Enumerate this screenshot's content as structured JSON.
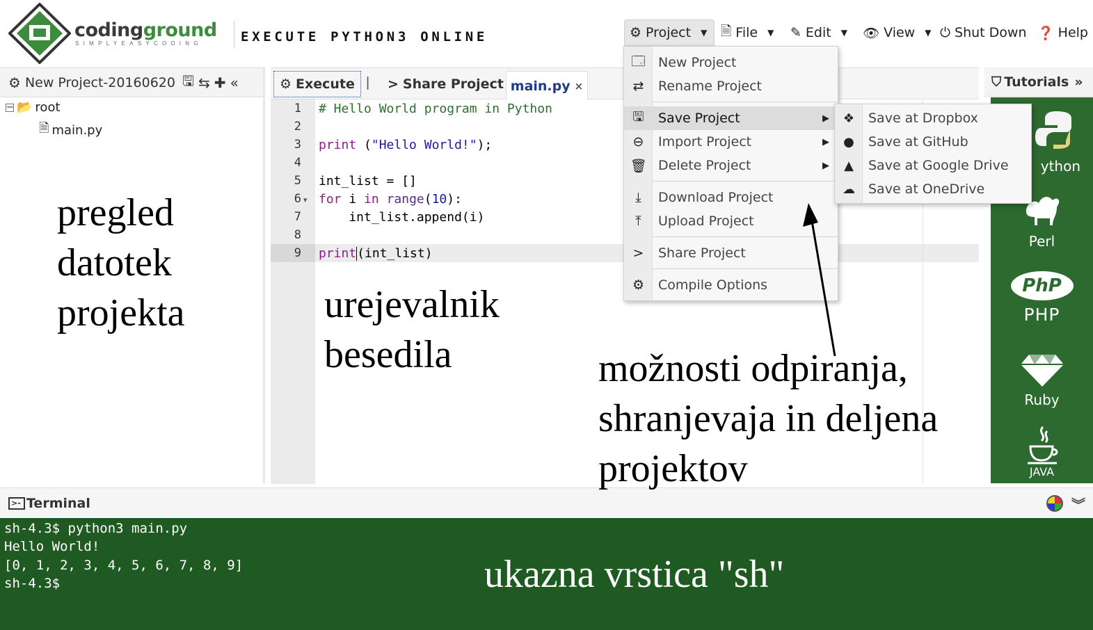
{
  "header": {
    "brand_part1": "coding",
    "brand_part2": "ground",
    "brand_tagline": "SIMPLYEASYCODING",
    "title": "EXECUTE PYTHON3 ONLINE",
    "menu": {
      "project": "Project",
      "file": "File",
      "edit": "Edit",
      "view": "View",
      "shutdown": "Shut Down",
      "help": "Help"
    }
  },
  "file_panel": {
    "project_name": "New Project-20160620",
    "tree": {
      "root": "root",
      "file": "main.py"
    }
  },
  "editor": {
    "execute_label": "Execute",
    "separator": "|",
    "share_label": "Share Project",
    "tab_label": "main.py",
    "tab_close": "×",
    "line_numbers": [
      "1",
      "2",
      "3",
      "4",
      "5",
      "6",
      "7",
      "8",
      "9"
    ]
  },
  "project_menu": {
    "items": {
      "new_project": "New Project",
      "rename_project": "Rename Project",
      "save_project": "Save Project",
      "import_project": "Import Project",
      "delete_project": "Delete Project",
      "download_project": "Download Project",
      "upload_project": "Upload Project",
      "share_project": "Share Project",
      "compile_options": "Compile Options"
    }
  },
  "save_submenu": {
    "dropbox": "Save at Dropbox",
    "github": "Save at GitHub",
    "google_drive": "Save at Google Drive",
    "onedrive": "Save at OneDrive"
  },
  "tutorials": {
    "header": "Tutorials",
    "items": {
      "python": "ython",
      "perl": "Perl",
      "php_logo": "PhP",
      "php": "PHP",
      "ruby": "Ruby",
      "java": "JAVA"
    }
  },
  "terminal": {
    "label": "Terminal",
    "lines": [
      "sh-4.3$ python3 main.py",
      "Hello World!",
      "[0, 1, 2, 3, 4, 5, 6, 7, 8, 9]",
      "sh-4.3$"
    ]
  },
  "annotations": {
    "files": [
      "pregled",
      "datotek",
      "projekta"
    ],
    "editor": [
      "urejevalnik",
      "besedila"
    ],
    "menu": [
      "možnosti odpiranja,",
      "shranjevaja in deljena",
      "projektov"
    ],
    "terminal": "ukazna vrstica \"sh\""
  },
  "colors": {
    "brand_green": "#3d8c3d",
    "tutorials_bg": "#2d6a2f",
    "terminal_bg": "#1e5a22"
  },
  "icons": [
    "logo-icon",
    "gear-icon",
    "caret-down-icon",
    "file-icon",
    "edit-icon",
    "eye-icon",
    "power-icon",
    "help-icon",
    "save-icon",
    "repeat-icon",
    "plus-icon",
    "collapse-icon",
    "folder-icon",
    "execute-gear-icon",
    "share-icon",
    "close-icon",
    "new-project-icon",
    "rename-icon",
    "import-icon",
    "trash-icon",
    "download-icon",
    "upload-icon",
    "compile-icon",
    "dropbox-icon",
    "github-icon",
    "google-drive-icon",
    "onedrive-icon",
    "tutorials-icon",
    "python-icon",
    "perl-camel-icon",
    "ruby-icon",
    "java-icon",
    "terminal-icon",
    "theme-icon",
    "chevron-double-down-icon"
  ]
}
